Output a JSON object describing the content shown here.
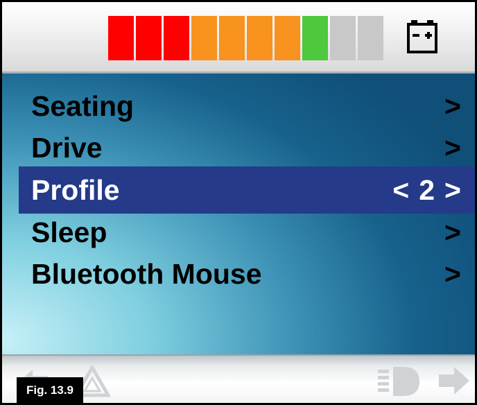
{
  "battery": {
    "segment_colors": [
      "#ff0000",
      "#ff0000",
      "#ff0000",
      "#f7931e",
      "#f7931e",
      "#f7931e",
      "#f7931e",
      "#4ec83c",
      "#c8c8c8",
      "#c8c8c8"
    ],
    "lit_segments": 8,
    "total_segments": 10,
    "icon": "battery-icon"
  },
  "menu": {
    "items": [
      {
        "label": "Seating",
        "arrow": ">"
      },
      {
        "label": "Drive",
        "arrow": ">"
      },
      {
        "label": "Profile",
        "prev": "<",
        "value": "2",
        "arrow": ">"
      },
      {
        "label": "Sleep",
        "arrow": ">"
      },
      {
        "label": "Bluetooth Mouse",
        "arrow": ">"
      }
    ],
    "selected_index": 2,
    "highlight_color": "#253a89"
  },
  "bottom": {
    "icons": [
      "back-arrow-icon",
      "hazard-icon",
      "headlight-icon",
      "forward-arrow-icon"
    ]
  },
  "figure_label": "Fig. 13.9"
}
